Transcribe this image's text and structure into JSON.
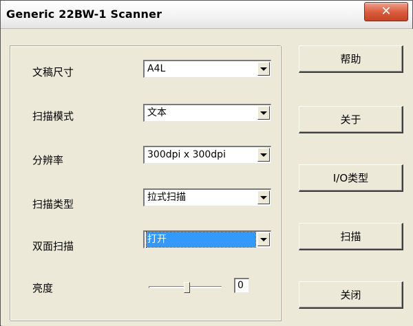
{
  "window": {
    "title": "Generic 22BW-1 Scanner",
    "close_glyph": "✕"
  },
  "settings": {
    "paper_size": {
      "label": "文稿尺寸",
      "value": "A4L"
    },
    "scan_mode": {
      "label": "扫描模式",
      "value": "文本"
    },
    "resolution": {
      "label": "分辨率",
      "value": "300dpi x 300dpi"
    },
    "scan_type": {
      "label": "扫描类型",
      "value": "拉式扫描"
    },
    "duplex": {
      "label": "双面扫描",
      "value": "打开"
    },
    "brightness": {
      "label": "亮度",
      "value": "0",
      "slider_fraction": 0.52
    }
  },
  "buttons": {
    "help": "帮助",
    "about": "关于",
    "io_type": "I/O类型",
    "scan": "扫描",
    "close": "关闭"
  },
  "colors": {
    "selection": "#3399ff",
    "close_button": "#d85a3b",
    "face": "#ece9d8"
  }
}
